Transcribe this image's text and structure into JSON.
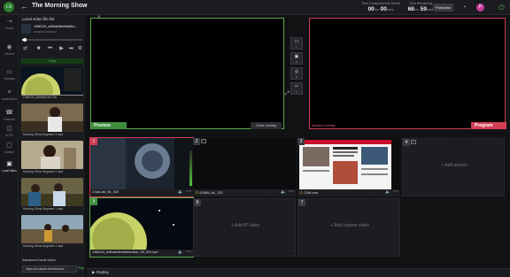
{
  "header": {
    "back_icon": "arrow-left-icon",
    "title": "The Morning Show",
    "time_consumed_label": "Time Consumed this Month",
    "time_consumed_h": "00",
    "time_consumed_m": "00",
    "time_remaining_label": "Time Remaining",
    "time_remaining_h": "68",
    "time_remaining_m": "59",
    "hrs": "hrs",
    "mins": "mins",
    "purchase_label": "Purchase",
    "avatar_letter": "P"
  },
  "nav": {
    "items": [
      {
        "icon": "output-icon",
        "label": "Output"
      },
      {
        "icon": "record-icon",
        "label": "Record"
      },
      {
        "icon": "overlays-icon",
        "label": "Overlays"
      },
      {
        "icon": "audio-mixer-icon",
        "label": "Audio Mixer"
      },
      {
        "icon": "intercom-icon",
        "label": "Intercom"
      },
      {
        "icon": "scte-icon",
        "label": "SCTE"
      },
      {
        "icon": "monitor-icon",
        "label": "Monitor"
      },
      {
        "icon": "local-video-icon",
        "label": "Local Video"
      }
    ]
  },
  "playlist": {
    "heading": "Local video file list",
    "now_playing_title": "1366134_aWhalelikethisMor...",
    "now_playing_time": "00:00:09 / 00:00:17",
    "progress": 0.05,
    "loop_label": "Loop",
    "items": [
      {
        "label": "1366134_aWhaleLikeThis",
        "time": ""
      },
      {
        "label": "Morning Show Segment 3.mp4"
      },
      {
        "label": "Morning Show Segment 2.mp4"
      },
      {
        "label": "Morning Show Segment 1.mp4"
      },
      {
        "label": "Morning Show Segment 4.mp4"
      }
    ],
    "advanced_label": "Advanced local video",
    "url_value": "https://producer.livestreamh...",
    "play_label": "Play"
  },
  "preview": {
    "label": "Preview",
    "clear_label": "Clear overlay"
  },
  "program": {
    "label": "Program",
    "advance_label": "Advance overlay"
  },
  "sources": [
    {
      "num": "1",
      "caption": "ChasCab_ML_SDI",
      "state": "program"
    },
    {
      "num": "2",
      "caption": "DUBAI_ML_SDI",
      "state": "normal"
    },
    {
      "num": "3",
      "caption": "CNN.com",
      "state": "normal"
    },
    {
      "num": "4",
      "caption": "",
      "add": "+ Add source"
    },
    {
      "num": "5",
      "caption": "1366134_aWhaleliketthisMor8bk_HD_BG.mp4",
      "state": "preview"
    },
    {
      "num": "6",
      "caption": "",
      "add": "+ Add IP video"
    },
    {
      "num": "7",
      "caption": "",
      "add": "+ Add custom video"
    }
  ],
  "bottom": {
    "replay_label": "Replay"
  },
  "colors": {
    "preview": "#5ea84a",
    "program": "#d13e56",
    "accent": "#3e8e3e"
  }
}
